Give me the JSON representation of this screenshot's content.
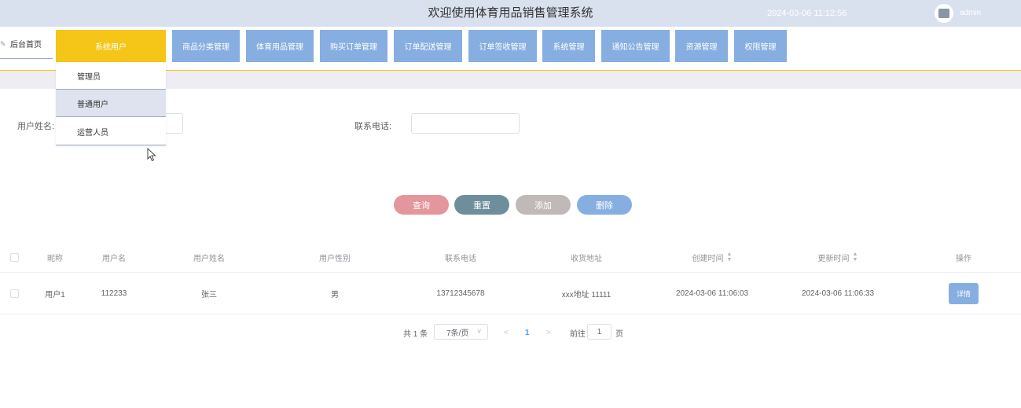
{
  "header": {
    "title": "欢迎使用体育用品销售管理系统",
    "datetime": "2024-03-06 11:12:56",
    "username": "admin"
  },
  "nav": {
    "home_label": "后台首页",
    "items": [
      {
        "label": "系统用户"
      },
      {
        "label": "商品分类管理"
      },
      {
        "label": "体育用品管理"
      },
      {
        "label": "购买订单管理"
      },
      {
        "label": "订单配送管理"
      },
      {
        "label": "订单签收管理"
      },
      {
        "label": "系统管理"
      },
      {
        "label": "通知公告管理"
      },
      {
        "label": "资源管理"
      },
      {
        "label": "权限管理"
      }
    ],
    "dropdown": [
      {
        "label": "管理员"
      },
      {
        "label": "普通用户"
      },
      {
        "label": "运营人员"
      }
    ]
  },
  "search": {
    "name_label": "用户姓名:",
    "name_value": "",
    "phone_label": "联系电话:",
    "phone_value": ""
  },
  "actions": {
    "query": "查询",
    "reset": "重置",
    "add": "添加",
    "delete": "删除"
  },
  "table": {
    "headers": [
      "昵称",
      "用户名",
      "用户姓名",
      "用户性别",
      "联系电话",
      "收货地址",
      "创建时间",
      "更新时间",
      "操作"
    ],
    "rows": [
      {
        "nickname": "用户1",
        "username": "112233",
        "realname": "张三",
        "gender": "男",
        "phone": "13712345678",
        "address": "xxx地址 11111",
        "created": "2024-03-06 11:06:03",
        "updated": "2024-03-06 11:06:33",
        "op": "详情"
      }
    ]
  },
  "pagination": {
    "total": "共 1 条",
    "page_size": "7条/页",
    "prev": "<",
    "current": "1",
    "next": ">",
    "goto_label": "前往",
    "goto_value": "1",
    "page_suffix": "页"
  },
  "colors": {
    "nav_button": "#87aee0",
    "nav_active": "#f5c518",
    "query": "#e3969c",
    "reset": "#6f8e9c",
    "add": "#c0b9b7",
    "delete": "#87aee0"
  }
}
